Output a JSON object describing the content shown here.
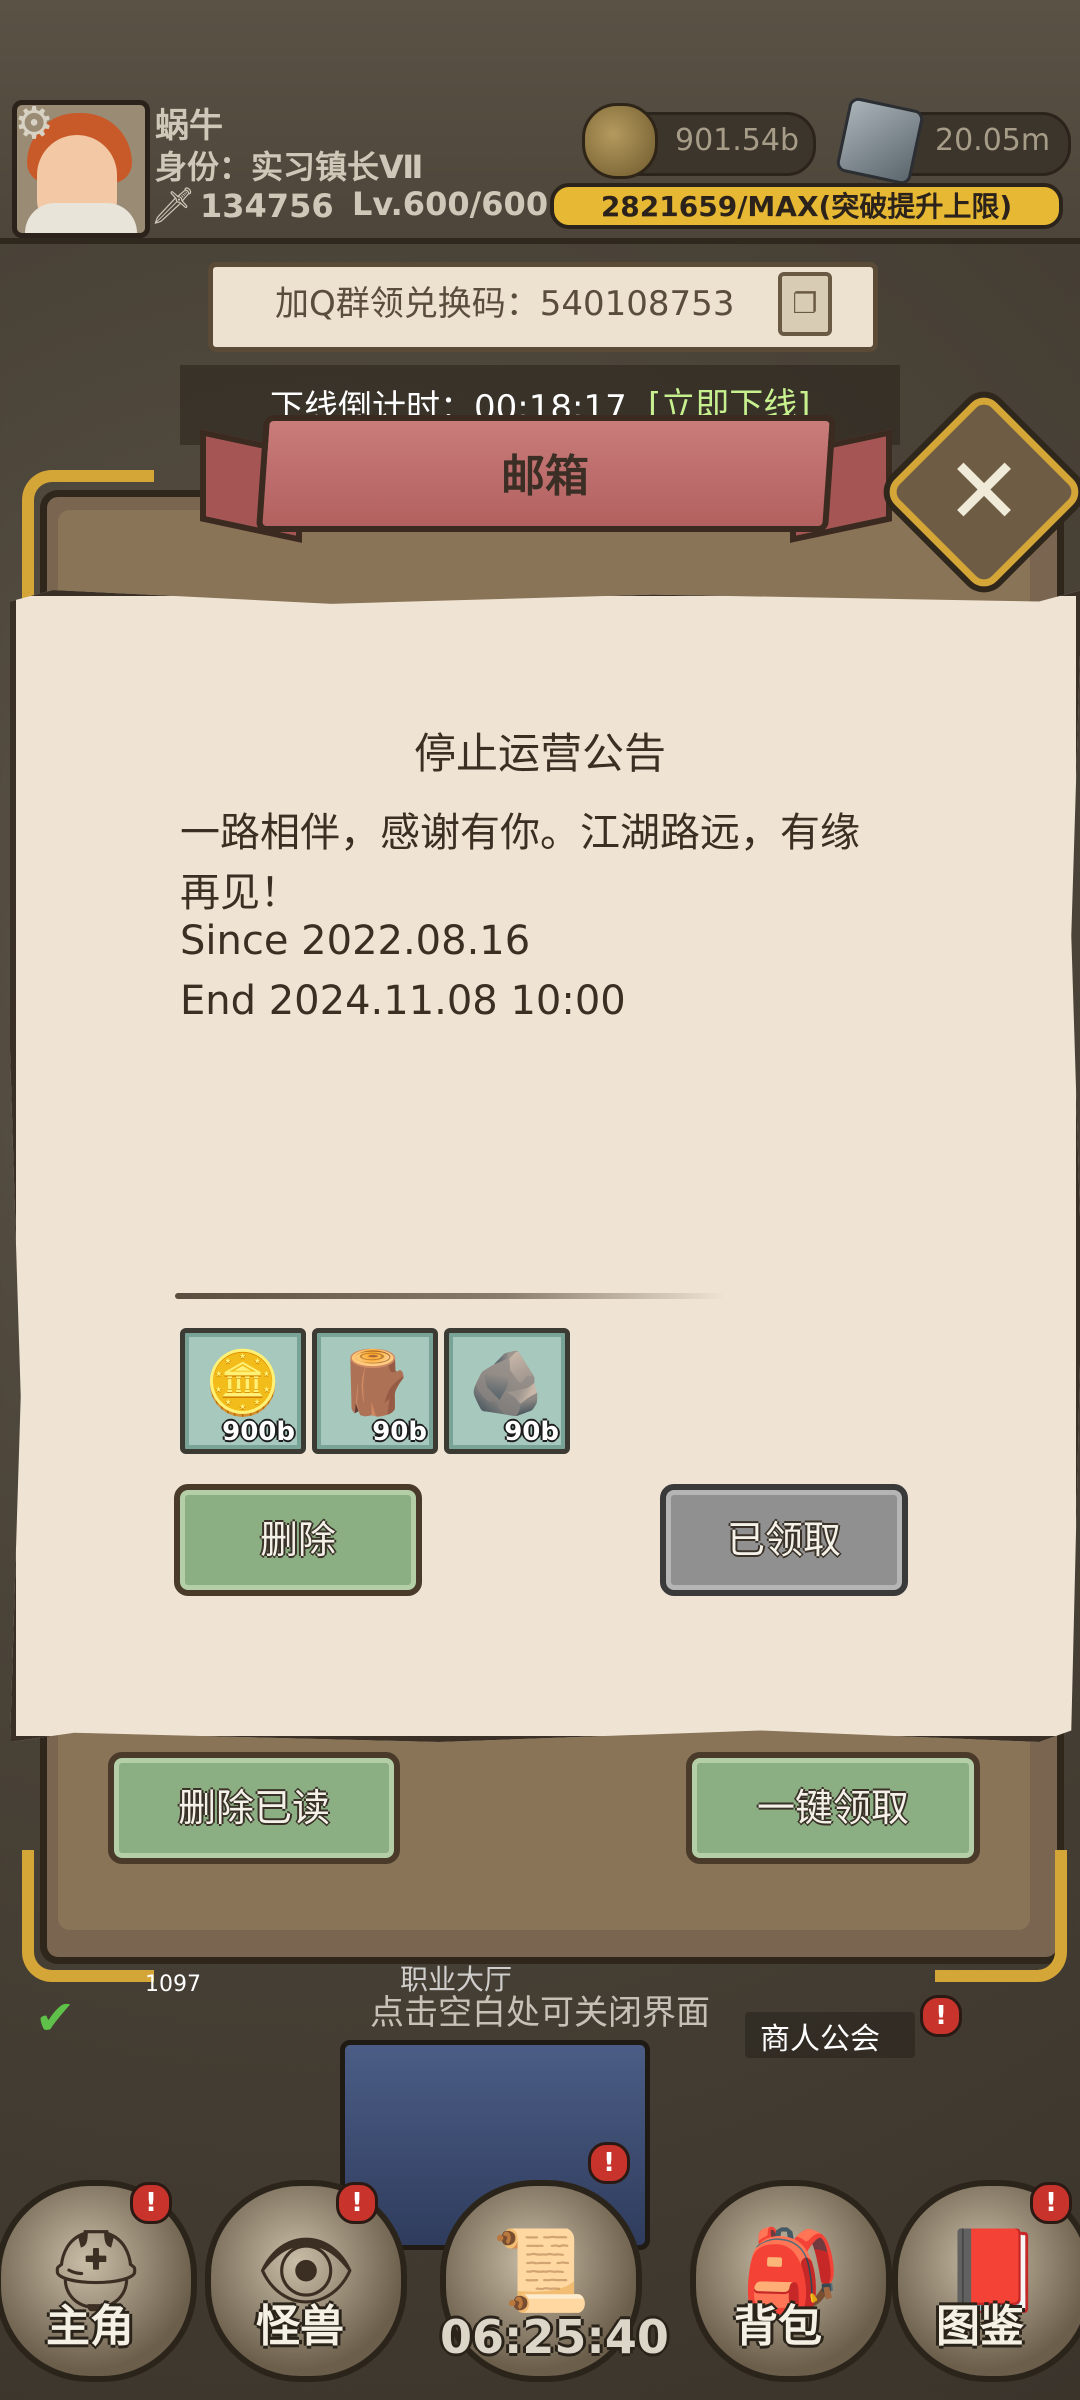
{
  "player": {
    "name": "蜗牛",
    "rank": "身份：实习镇长Ⅶ",
    "power": "134756",
    "level": "Lv.600/600",
    "exp_text": "2821659/MAX(突破提升上限)"
  },
  "resources": {
    "coins": "901.54b",
    "ore": "20.05m"
  },
  "banner": {
    "code_text": "加Q群领兑换码：540108753"
  },
  "countdown": {
    "label": "下线倒计时：00:18:17",
    "offline_link": "[立即下线]"
  },
  "mailbox": {
    "title": "邮箱",
    "mail_title": "停止运营公告",
    "body_lines": [
      "一路相伴，感谢有你。江湖路远，有缘",
      "再见！",
      "Since 2022.08.16",
      "End   2024.11.08 10:00"
    ],
    "attachments": [
      {
        "icon": "coin-icon",
        "qty": "900b"
      },
      {
        "icon": "wood-log-icon",
        "qty": "90b"
      },
      {
        "icon": "stone-ore-icon",
        "qty": "90b"
      }
    ],
    "delete_label": "删除",
    "claimed_label": "已领取",
    "delete_read_label": "删除已读",
    "claim_all_label": "一键领取"
  },
  "background": {
    "guild_hall": "职业大厅",
    "close_hint": "点击空白处可关闭界面",
    "merchant_guild": "商人公会",
    "badge_count": "1097"
  },
  "bottom_nav": {
    "items": [
      "主角",
      "怪兽",
      "",
      "背包",
      "图鉴"
    ],
    "timer": "06:25:40"
  },
  "colors": {
    "accent_gold": "#d4a537",
    "ribbon_red": "#c97c7a",
    "button_green": "#8cae83",
    "button_gray": "#909090",
    "link_green": "#c7f08f",
    "notification_red": "#c8342c"
  }
}
